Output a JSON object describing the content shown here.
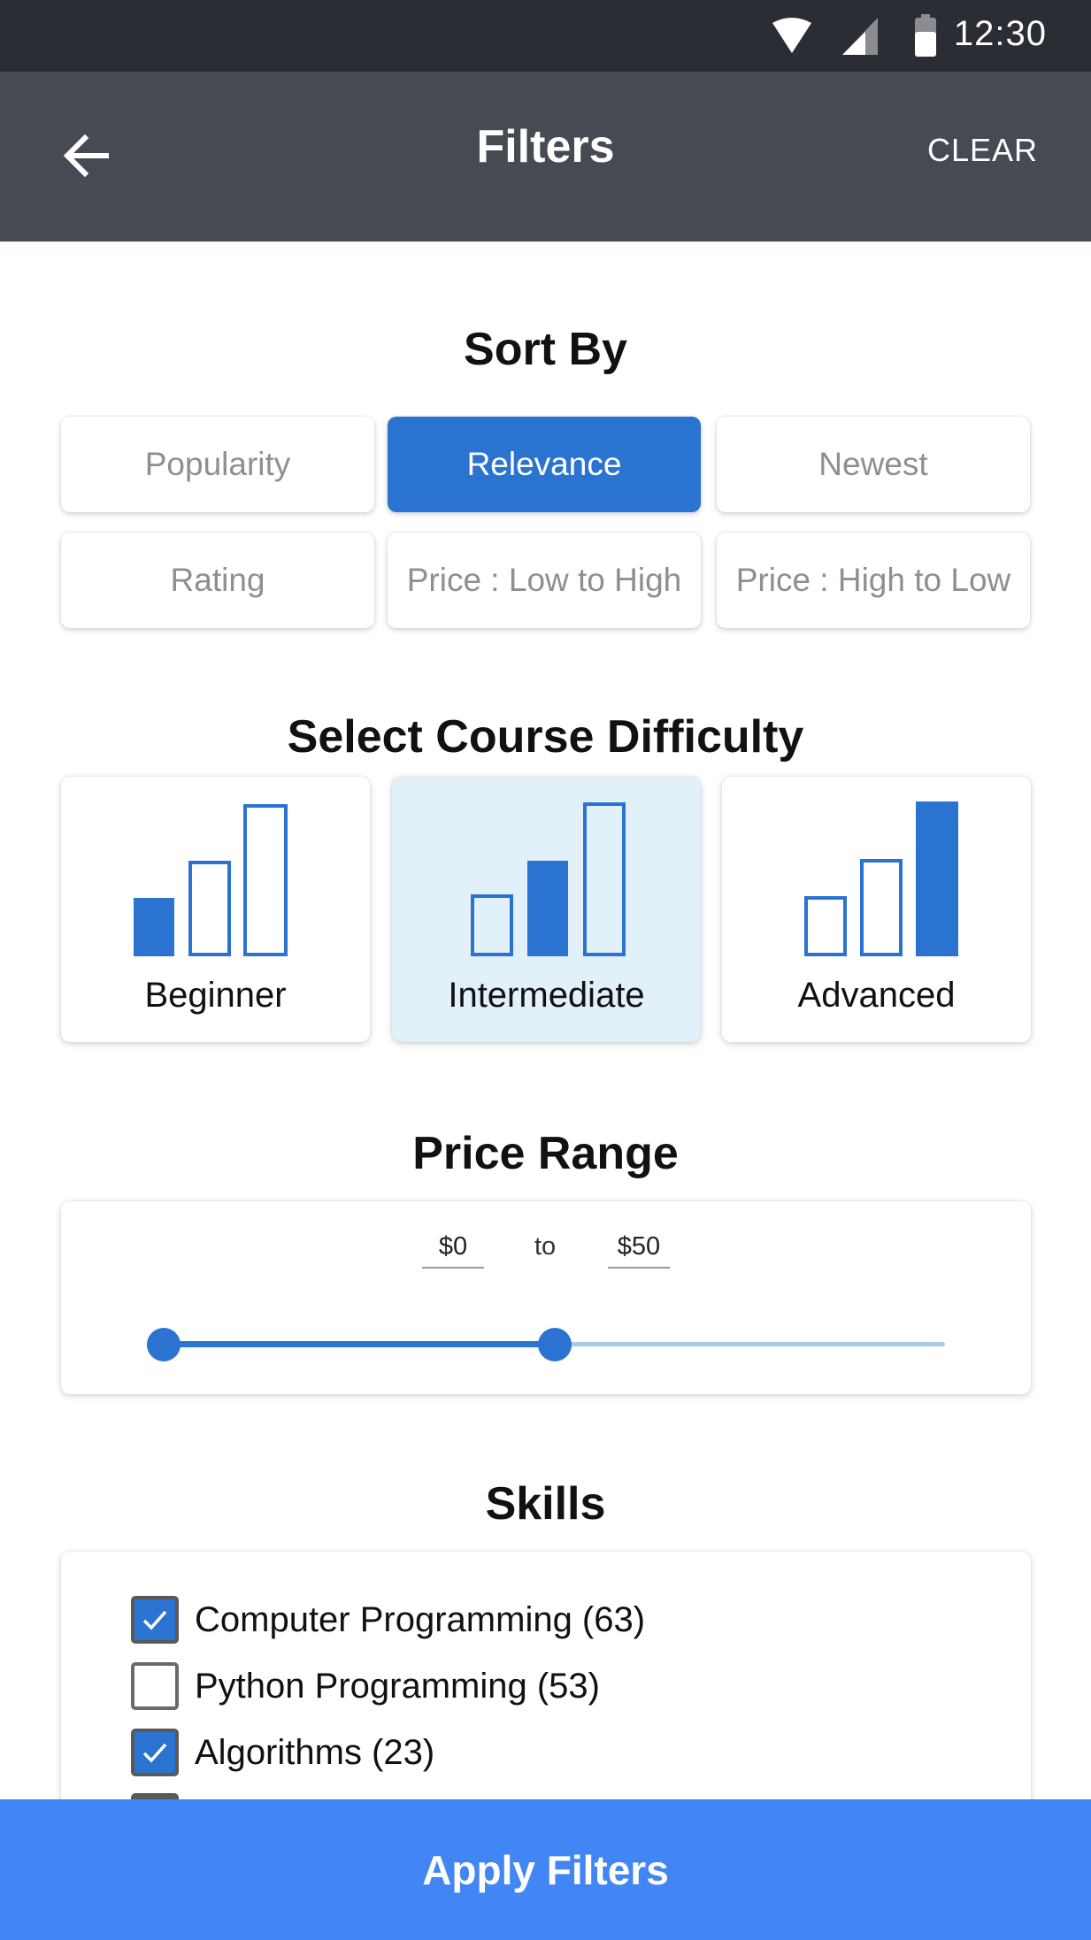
{
  "status_bar": {
    "time": "12:30"
  },
  "header": {
    "title": "Filters",
    "clear_label": "CLEAR"
  },
  "sort": {
    "title": "Sort By",
    "options": [
      "Popularity",
      "Relevance",
      "Newest",
      "Rating",
      "Price : Low to High",
      "Price : High to Low"
    ],
    "selected": "Relevance"
  },
  "difficulty": {
    "title": "Select Course Difficulty",
    "options": [
      {
        "label": "Beginner",
        "level": 1
      },
      {
        "label": "Intermediate",
        "level": 2
      },
      {
        "label": "Advanced",
        "level": 3
      }
    ],
    "selected": "Intermediate"
  },
  "price": {
    "title": "Price Range",
    "min_label": "$0",
    "to_label": "to",
    "max_label": "$50",
    "range_fraction": [
      0,
      0.5
    ]
  },
  "skills": {
    "title": "Skills",
    "items": [
      {
        "label": "Computer Programming (63)",
        "checked": true
      },
      {
        "label": "Python Programming (53)",
        "checked": false
      },
      {
        "label": "Algorithms (23)",
        "checked": true
      }
    ]
  },
  "footer": {
    "apply_label": "Apply Filters"
  },
  "colors": {
    "accent": "#2b73d0",
    "apply": "#4285f4",
    "header": "#454a53",
    "status": "#2a2d34",
    "selected_card": "#e2f0fa"
  }
}
